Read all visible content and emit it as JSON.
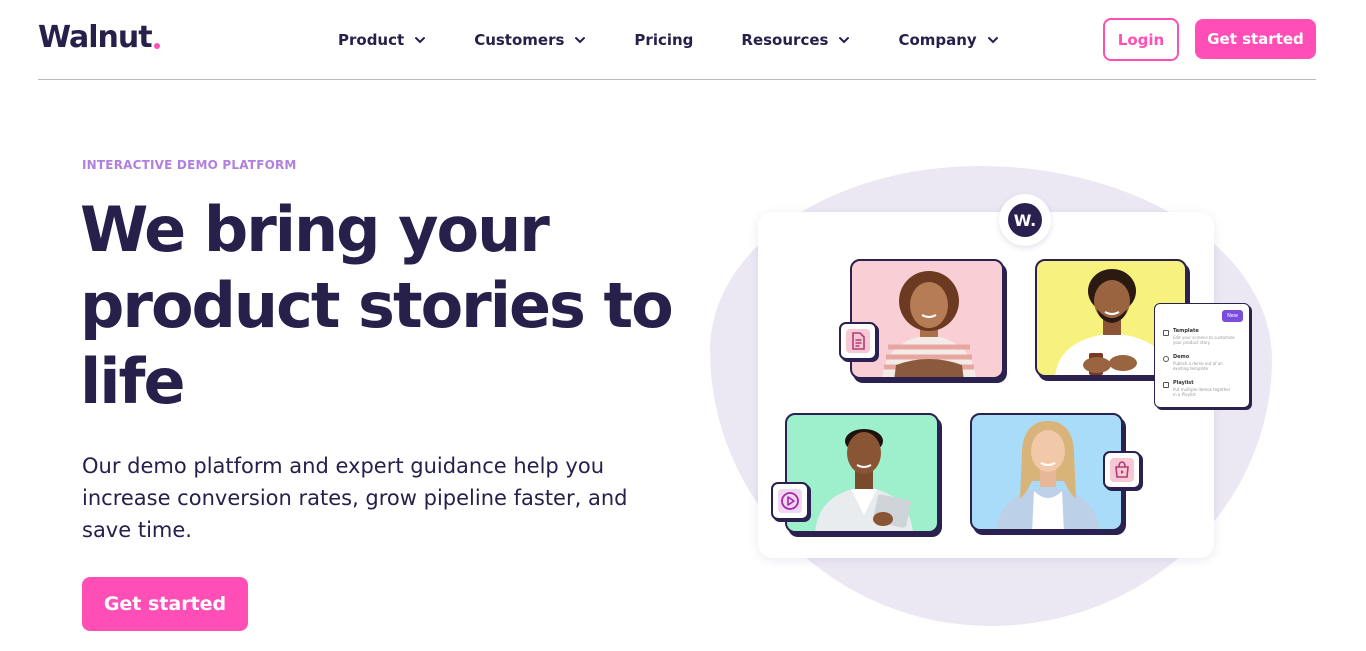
{
  "header": {
    "logo": "Walnut",
    "nav": [
      {
        "label": "Product",
        "dropdown": true
      },
      {
        "label": "Customers",
        "dropdown": true
      },
      {
        "label": "Pricing",
        "dropdown": false
      },
      {
        "label": "Resources",
        "dropdown": true
      },
      {
        "label": "Company",
        "dropdown": true
      }
    ],
    "login_label": "Login",
    "get_started_label": "Get started"
  },
  "hero": {
    "eyebrow": "INTERACTIVE DEMO PLATFORM",
    "headline": "We bring your product stories to life",
    "subtext": "Our demo platform and expert guidance help you increase conversion rates, grow pipeline faster, and save time.",
    "cta_label": "Get started"
  },
  "illustration": {
    "badge_letter": "W.",
    "menu_new_label": "New",
    "menu_items": [
      {
        "title": "Template",
        "desc": "Edit your screens to customize your product story"
      },
      {
        "title": "Demo",
        "desc": "Publish a demo out of an existing template"
      },
      {
        "title": "Playlist",
        "desc": "Put multiple demos together in a Playlist"
      }
    ]
  },
  "colors": {
    "accent": "#ff4fb6",
    "ink": "#26204a",
    "eyebrow": "#b07fe0",
    "blob": "#ece8f3"
  }
}
